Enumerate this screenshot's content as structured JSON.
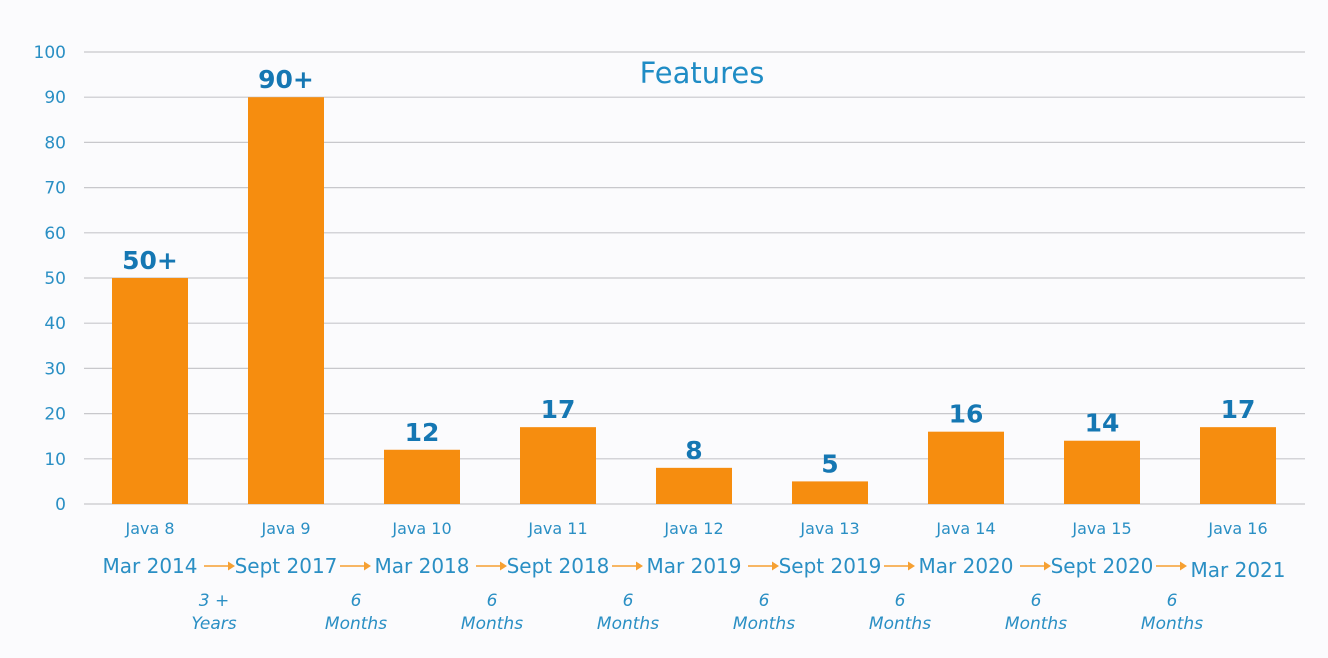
{
  "chart_data": {
    "type": "bar",
    "title": "Features",
    "xlabel": "",
    "ylabel": "",
    "ylim": [
      0,
      100
    ],
    "yticks": [
      0,
      10,
      20,
      30,
      40,
      50,
      60,
      70,
      80,
      90,
      100
    ],
    "grid": true,
    "categories": [
      "Java 8",
      "Java 9",
      "Java 10",
      "Java 11",
      "Java 12",
      "Java 13",
      "Java 14",
      "Java 15",
      "Java 16"
    ],
    "values": [
      50,
      90,
      12,
      17,
      8,
      5,
      16,
      14,
      17
    ],
    "data_labels": [
      "50+",
      "90+",
      "12",
      "17",
      "8",
      "5",
      "16",
      "14",
      "17"
    ],
    "release_dates": [
      "Mar 2014",
      "Sept 2017",
      "Mar 2018",
      "Sept 2018",
      "Mar 2019",
      "Sept 2019",
      "Mar 2020",
      "Sept 2020",
      "Mar 2021"
    ],
    "intervals": [
      {
        "amount": "3 +",
        "unit": "Years"
      },
      {
        "amount": "6",
        "unit": "Months"
      },
      {
        "amount": "6",
        "unit": "Months"
      },
      {
        "amount": "6",
        "unit": "Months"
      },
      {
        "amount": "6",
        "unit": "Months"
      },
      {
        "amount": "6",
        "unit": "Months"
      },
      {
        "amount": "6",
        "unit": "Months"
      },
      {
        "amount": "6",
        "unit": "Months"
      }
    ],
    "colors": {
      "bar": "#f68d0f",
      "text": "#2a8fc4",
      "data_label": "#1577b3",
      "arrow": "#f6a032",
      "grid": "#c8c8cc"
    }
  }
}
